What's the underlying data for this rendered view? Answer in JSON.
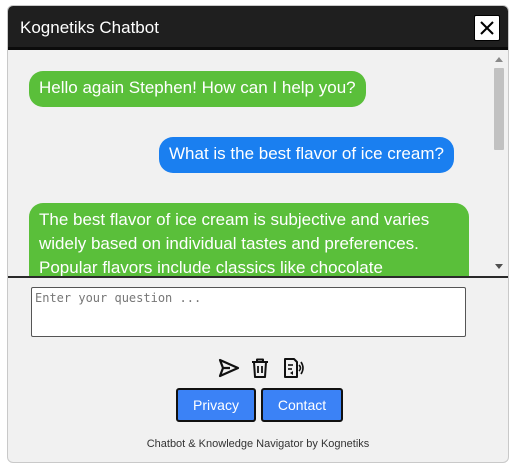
{
  "window": {
    "title": "Kognetiks Chatbot"
  },
  "messages": [
    {
      "role": "bot",
      "text": "Hello again Stephen! How can I help you?"
    },
    {
      "role": "user",
      "text": "What is the best flavor of ice cream?"
    },
    {
      "role": "bot",
      "text": "The best flavor of ice cream is subjective and varies widely based on individual tastes and preferences. Popular flavors include classics like chocolate"
    }
  ],
  "input": {
    "placeholder": "Enter your question ...",
    "value": ""
  },
  "actions": {
    "icons": [
      "send-icon",
      "trash-icon",
      "read-aloud-icon"
    ]
  },
  "buttons": {
    "privacy": "Privacy",
    "contact": "Contact"
  },
  "footer": {
    "text": "Chatbot & Knowledge Navigator by Kognetiks"
  },
  "colors": {
    "titlebar": "#1f1f1f",
    "bot_bubble": "#5abf3a",
    "user_bubble": "#1a7ff0",
    "button": "#3b82f6"
  }
}
